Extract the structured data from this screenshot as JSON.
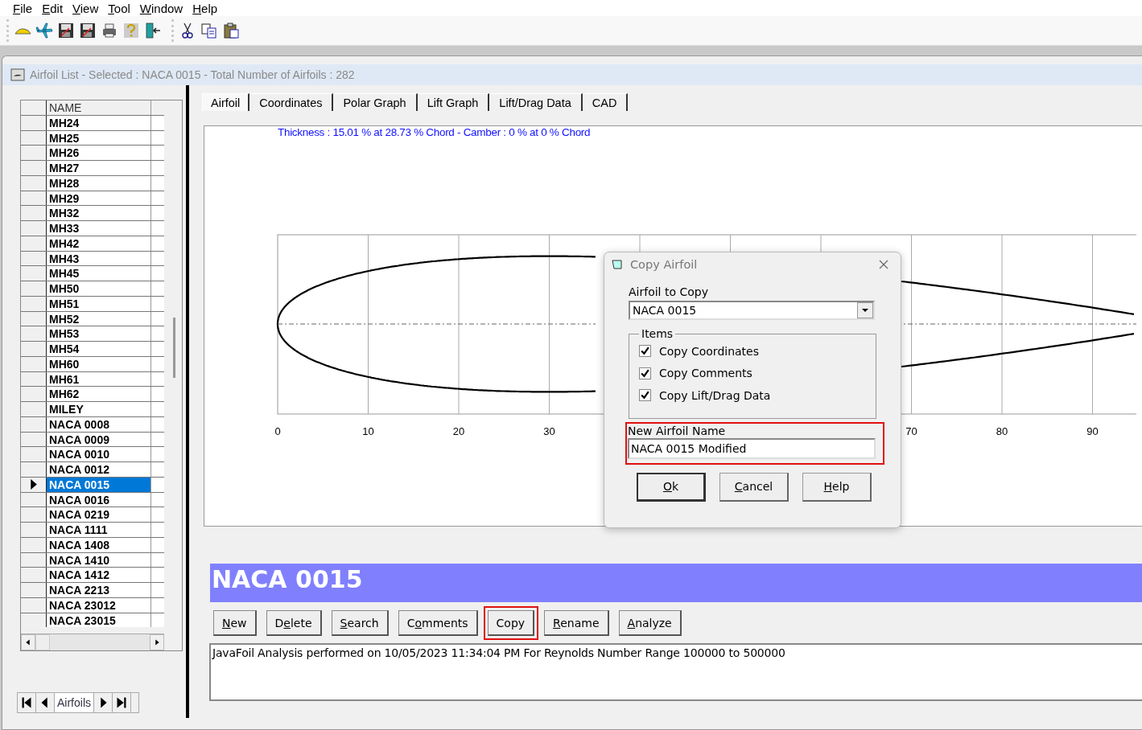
{
  "menu": [
    {
      "key": "F",
      "post": "ile"
    },
    {
      "key": "E",
      "post": "dit"
    },
    {
      "key": "V",
      "post": "iew"
    },
    {
      "key": "T",
      "post": "ool"
    },
    {
      "key": "W",
      "post": "indow"
    },
    {
      "key": "H",
      "post": "elp"
    }
  ],
  "window": {
    "title": "Airfoil List - Selected : NACA 0015 - Total Number of Airfoils : 282",
    "active": false
  },
  "grid": {
    "header": "NAME",
    "rows": [
      {
        "name": "MH24",
        "selected": false
      },
      {
        "name": "MH25",
        "selected": false
      },
      {
        "name": "MH26",
        "selected": false
      },
      {
        "name": "MH27",
        "selected": false
      },
      {
        "name": "MH28",
        "selected": false
      },
      {
        "name": "MH29",
        "selected": false
      },
      {
        "name": "MH32",
        "selected": false
      },
      {
        "name": "MH33",
        "selected": false
      },
      {
        "name": "MH42",
        "selected": false
      },
      {
        "name": "MH43",
        "selected": false
      },
      {
        "name": "MH45",
        "selected": false
      },
      {
        "name": "MH50",
        "selected": false
      },
      {
        "name": "MH51",
        "selected": false
      },
      {
        "name": "MH52",
        "selected": false
      },
      {
        "name": "MH53",
        "selected": false
      },
      {
        "name": "MH54",
        "selected": false
      },
      {
        "name": "MH60",
        "selected": false
      },
      {
        "name": "MH61",
        "selected": false
      },
      {
        "name": "MH62",
        "selected": false
      },
      {
        "name": "MILEY",
        "selected": false
      },
      {
        "name": "NACA 0008",
        "selected": false
      },
      {
        "name": "NACA 0009",
        "selected": false
      },
      {
        "name": "NACA 0010",
        "selected": false
      },
      {
        "name": "NACA 0012",
        "selected": false
      },
      {
        "name": "NACA 0015",
        "selected": true
      },
      {
        "name": "NACA 0016",
        "selected": false
      },
      {
        "name": "NACA 0219",
        "selected": false
      },
      {
        "name": "NACA 1111",
        "selected": false
      },
      {
        "name": "NACA 1408",
        "selected": false
      },
      {
        "name": "NACA 1410",
        "selected": false
      },
      {
        "name": "NACA 1412",
        "selected": false
      },
      {
        "name": "NACA 2213",
        "selected": false
      },
      {
        "name": "NACA 23012",
        "selected": false
      },
      {
        "name": "NACA 23015",
        "selected": false
      }
    ]
  },
  "navigator": {
    "label": "Airfoils"
  },
  "tabs": [
    {
      "label": "Airfoil",
      "selected": true
    },
    {
      "label": "Coordinates",
      "selected": false
    },
    {
      "label": "Polar Graph",
      "selected": false
    },
    {
      "label": "Lift Graph",
      "selected": false
    },
    {
      "label": "Lift/Drag Data",
      "selected": false
    },
    {
      "label": "CAD",
      "selected": false
    }
  ],
  "plot": {
    "info": "Thickness : 15.01 % at 28.73 % Chord - Camber : 0 % at 0 % Chord",
    "x_tick_labels": [
      "0",
      "10",
      "20",
      "30",
      "70",
      "80",
      "90"
    ]
  },
  "airfoil_name": "NACA 0015",
  "buttons": [
    {
      "key": "N",
      "post": "ew",
      "highlighted": false
    },
    {
      "pre": "D",
      "key": "e",
      "post": "lete",
      "highlighted": false
    },
    {
      "key": "S",
      "post": "earch",
      "highlighted": false
    },
    {
      "pre": "C",
      "key": "o",
      "post": "mments",
      "highlighted": false
    },
    {
      "pre": "Copy",
      "highlighted": true
    },
    {
      "key": "R",
      "post": "ename",
      "highlighted": false
    },
    {
      "key": "A",
      "post": "nalyze",
      "highlighted": false
    }
  ],
  "comments": "JavaFoil Analysis performed on 10/05/2023 11:34:04 PM  For Reynolds Number Range 100000 to 500000",
  "dialog": {
    "title": "Copy Airfoil",
    "airfoil_label": "Airfoil to Copy",
    "airfoil_value": "NACA 0015",
    "items_legend": "Items",
    "items": [
      {
        "label": "Copy Coordinates",
        "checked": true
      },
      {
        "label": "Copy Comments",
        "checked": true
      },
      {
        "label": "Copy Lift/Drag Data",
        "checked": true
      }
    ],
    "name_label": "New Airfoil Name",
    "name_value": "NACA 0015 Modified",
    "name_highlighted": true,
    "buttons": [
      {
        "key": "O",
        "post": "k",
        "default": true
      },
      {
        "key": "C",
        "post": "ancel",
        "default": false
      },
      {
        "key": "H",
        "post": "elp",
        "default": false
      }
    ]
  }
}
